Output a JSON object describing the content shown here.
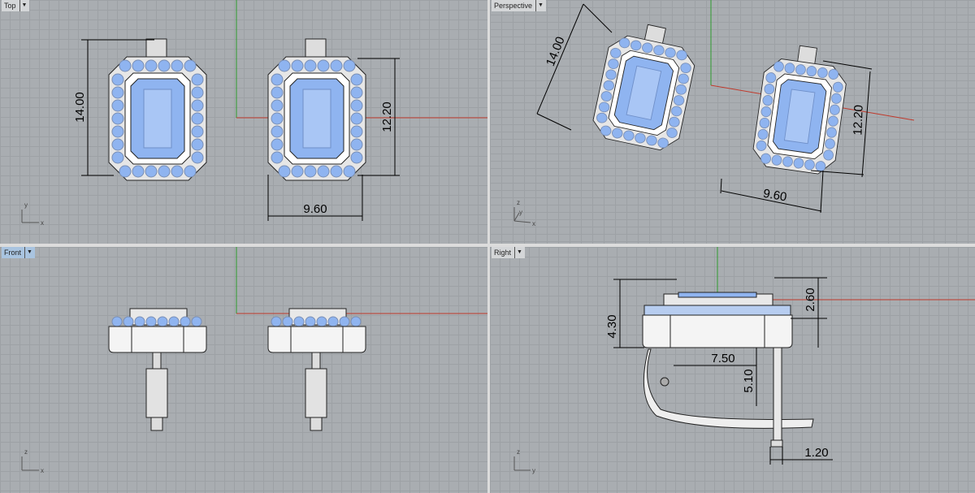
{
  "viewports": [
    {
      "name": "Top",
      "active": false,
      "axes": [
        "y",
        "x"
      ],
      "dims": [
        "14.00",
        "12.20",
        "9.60"
      ]
    },
    {
      "name": "Perspective",
      "active": false,
      "axes": [
        "z",
        "y",
        "x"
      ],
      "dims": [
        "14.00",
        "12.20",
        "9.60"
      ]
    },
    {
      "name": "Front",
      "active": true,
      "axes": [
        "z",
        "x"
      ],
      "dims": []
    },
    {
      "name": "Right",
      "active": false,
      "axes": [
        "z",
        "y"
      ],
      "dims": [
        "4.30",
        "2.60",
        "7.50",
        "5.10",
        "1.20"
      ]
    }
  ],
  "dropdown_icon": "chevron-down-icon",
  "colors": {
    "background": "#a9adb1",
    "grid": "#9da1a5",
    "gem": "#8fb4f0",
    "metal": "#f2f2f2",
    "x_axis": "#c0392b",
    "y_axis": "#2e9a2e"
  }
}
